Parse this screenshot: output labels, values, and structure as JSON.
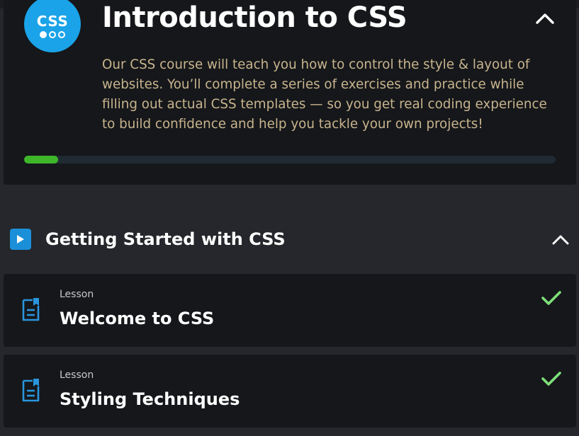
{
  "course": {
    "badge_text": "CSS",
    "title": "Introduction to CSS",
    "description": "Our CSS course will teach you how to control the style & layout of websites. You’ll complete a series of exercises and practice while filling out actual CSS templates — so you get real coding experience to build confidence and help you tackle your own projects!",
    "progress_fraction": 0.064,
    "colors": {
      "badge": "#1aa3e8",
      "progress": "#3fb62a",
      "description_text": "#c8b48e"
    }
  },
  "section": {
    "title": "Getting Started with CSS",
    "icon": "play-icon",
    "expanded": true
  },
  "lessons": [
    {
      "type_label": "Lesson",
      "title": "Welcome to CSS",
      "completed": true,
      "icon": "lesson-document-icon"
    },
    {
      "type_label": "Lesson",
      "title": "Styling Techniques",
      "completed": true,
      "icon": "lesson-document-icon"
    }
  ],
  "icons": {
    "collapse": "chevron-up-icon",
    "completed": "checkmark-icon"
  }
}
